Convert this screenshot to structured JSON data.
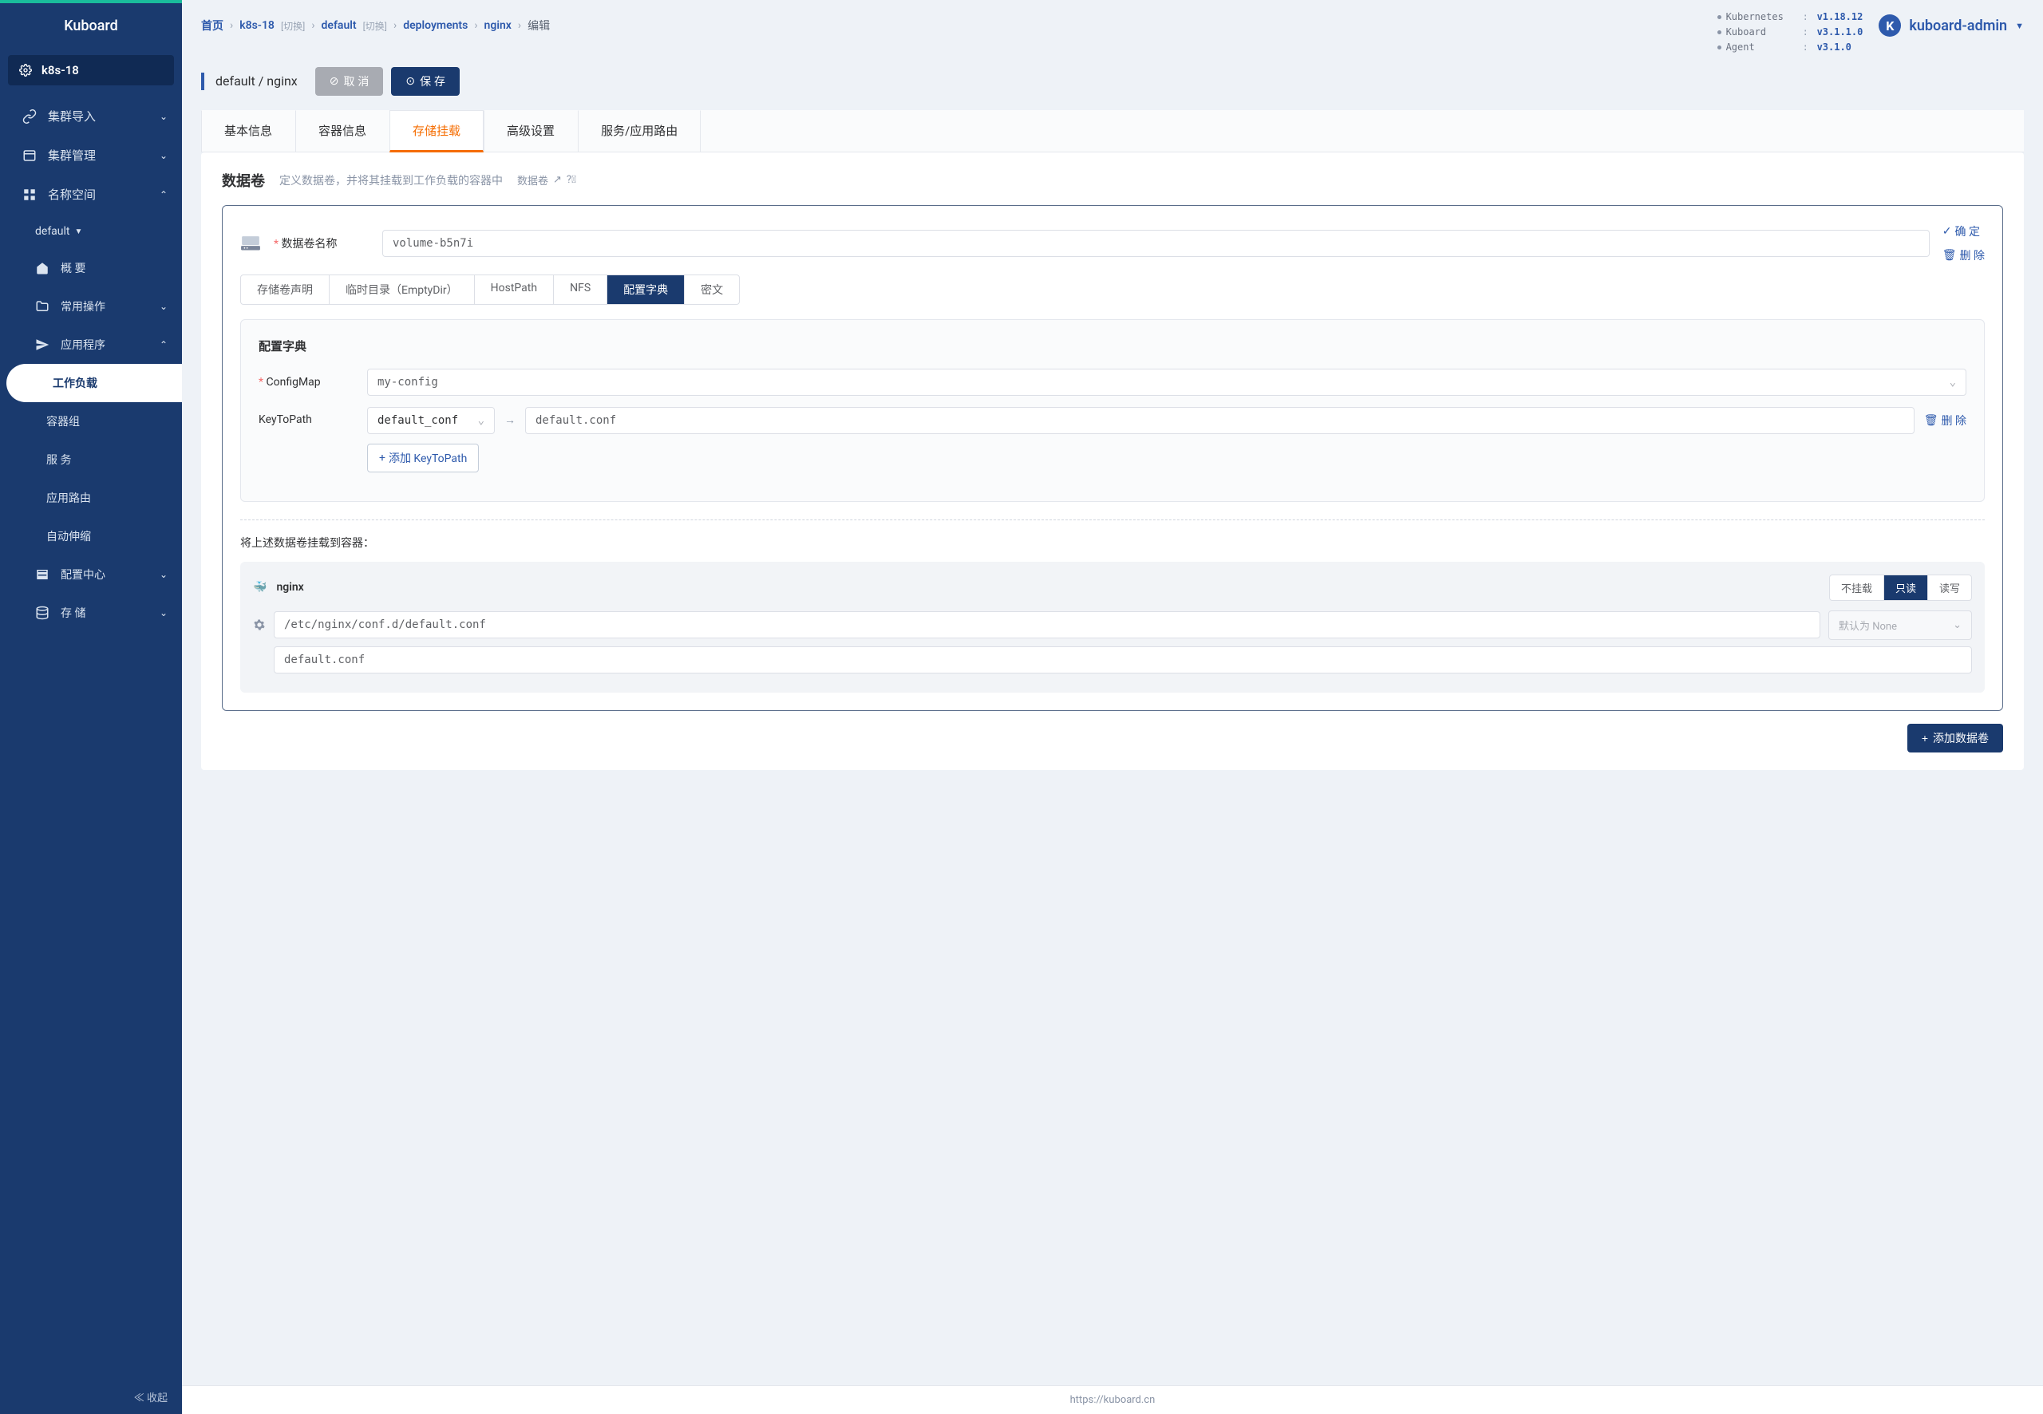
{
  "brand": "Kuboard",
  "cluster_name": "k8s-18",
  "sidebar": {
    "import": "集群导入",
    "manage": "集群管理",
    "namespace": "名称空间",
    "default_ns": "default",
    "overview": "概 要",
    "common": "常用操作",
    "apps": "应用程序",
    "workload": "工作负载",
    "pods": "容器组",
    "services": "服 务",
    "ingress": "应用路由",
    "hpa": "自动伸缩",
    "config": "配置中心",
    "storage": "存 储",
    "collapse": "收起"
  },
  "breadcrumb": {
    "home": "首页",
    "cluster": "k8s-18",
    "cluster_switch": "[切换]",
    "ns": "default",
    "ns_switch": "[切换]",
    "deployments": "deployments",
    "name": "nginx",
    "edit": "编辑"
  },
  "versions": {
    "k8s_k": "Kubernetes",
    "k8s_v": "v1.18.12",
    "kb_k": "Kuboard",
    "kb_v": "v3.1.1.0",
    "ag_k": "Agent",
    "ag_v": "v3.1.0"
  },
  "user": "kuboard-admin",
  "title": "default / nginx",
  "buttons": {
    "cancel": "取 消",
    "save": "保 存",
    "confirm": "确 定",
    "delete": "删 除",
    "add_ktp": "添加 KeyToPath",
    "add_vol": "添加数据卷"
  },
  "tabs": {
    "basic": "基本信息",
    "container": "容器信息",
    "volume": "存储挂载",
    "advanced": "高级设置",
    "service": "服务/应用路由"
  },
  "section": {
    "h": "数据卷",
    "d": "定义数据卷，并将其挂载到工作负载的容器中",
    "help": "数据卷"
  },
  "vol": {
    "name_lbl": "数据卷名称",
    "name_val": "volume-b5n7i"
  },
  "subtabs": {
    "pvc": "存储卷声明",
    "empty": "临时目录（EmptyDir）",
    "hostpath": "HostPath",
    "nfs": "NFS",
    "cm": "配置字典",
    "secret": "密文"
  },
  "cm": {
    "h": "配置字典",
    "lbl": "ConfigMap",
    "val": "my-config",
    "ktp_lbl": "KeyToPath",
    "ktp_key": "default_conf",
    "ktp_path": "default.conf"
  },
  "mount": {
    "h": "将上述数据卷挂载到容器：",
    "container": "nginx",
    "seg_none": "不挂载",
    "seg_ro": "只读",
    "seg_rw": "读写",
    "path": "/etc/nginx/conf.d/default.conf",
    "subpath": "default.conf",
    "propagation": "默认为 None"
  },
  "footer": "https://kuboard.cn"
}
